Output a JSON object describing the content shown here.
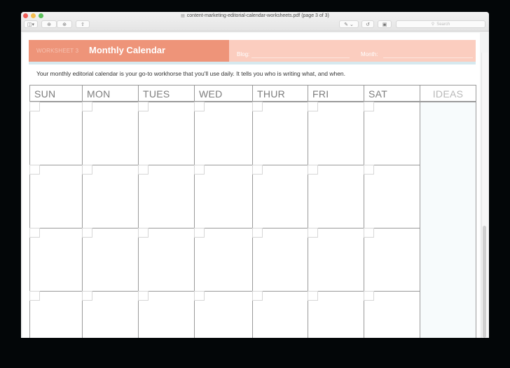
{
  "window": {
    "title": "content-marketing-editorial-calendar-worksheets.pdf (page 3 of 3)",
    "toolbar": {
      "sidebar_icon": "sidebar-toggle-icon",
      "zoom_out_icon": "zoom-out-icon",
      "zoom_in_icon": "zoom-in-icon",
      "share_icon": "share-icon",
      "markup_icon": "pen-icon",
      "rotate_icon": "rotate-icon",
      "toolbox_icon": "toolbox-icon",
      "search_placeholder": "Search"
    }
  },
  "document": {
    "worksheet_label": "WORKSHEET 3",
    "title": "Monthly Calendar",
    "blog_label": "Blog:",
    "month_label": "Month:",
    "intro": "Your monthly editorial calendar is your go-to workhorse that you'll use daily. It tells you who is writing what, and when.",
    "calendar": {
      "headers": [
        "SUN",
        "MON",
        "TUES",
        "WED",
        "THUR",
        "FRI",
        "SAT",
        "IDEAS"
      ],
      "visible_week_rows": 4
    },
    "colors": {
      "banner_dark": "#ee9479",
      "banner_light": "#fbcdbf",
      "banner_stripe": "#d6e8ee",
      "grid_line": "#9a9a9a",
      "ideas_bg": "#f7fbfc"
    }
  }
}
